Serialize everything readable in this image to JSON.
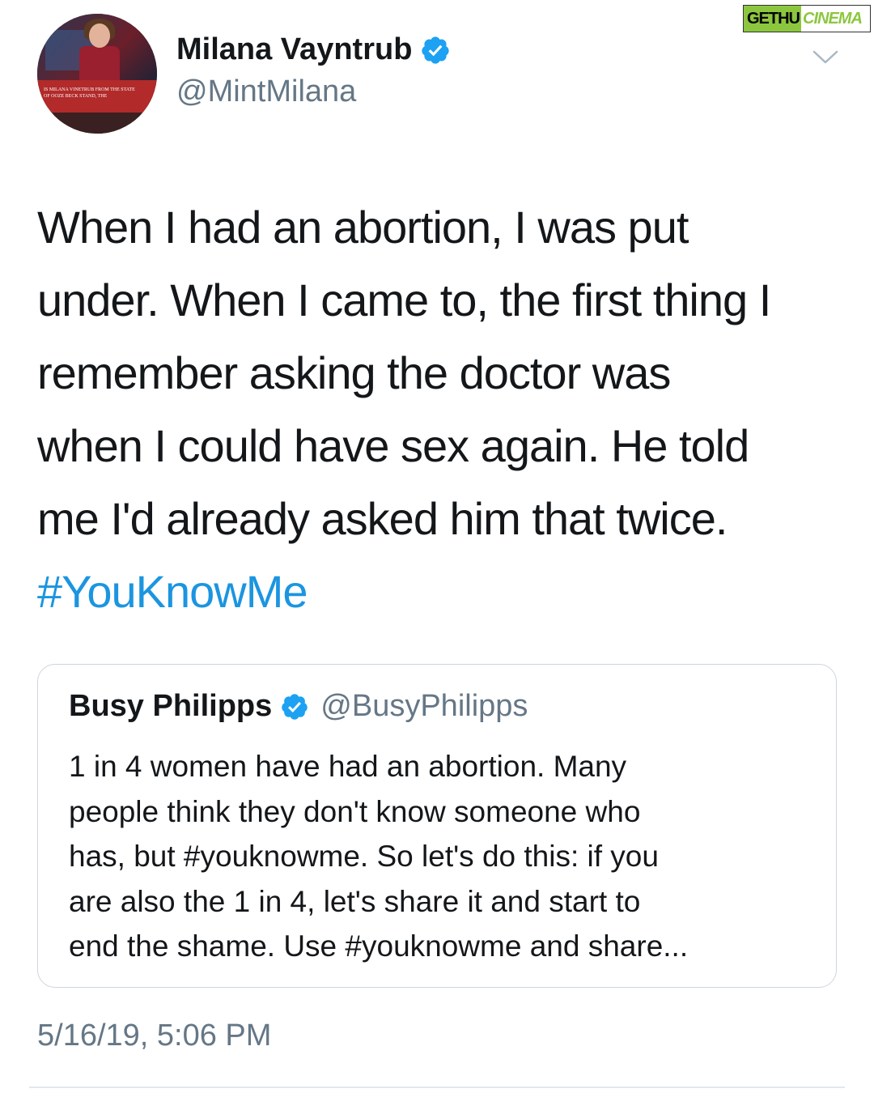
{
  "watermark": {
    "part1": "GETHU",
    "part2": "CINEMA"
  },
  "author": {
    "display_name": "Milana Vayntrub",
    "handle": "@MintMilana",
    "avatar_caption": "IS MILANA VINETRUB FROM THE STATE OF OOZE BECK STAND, THE"
  },
  "tweet": {
    "lines": [
      "When I had an abortion, I was put",
      "under. When I came to, the first thing I",
      "remember asking the doctor was",
      "when I could have sex again. He told",
      "me I'd already asked him that twice."
    ],
    "hashtag": "#YouKnowMe",
    "timestamp": "5/16/19, 5:06 PM"
  },
  "quoted": {
    "display_name": "Busy Philipps",
    "handle": "@BusyPhilipps",
    "lines": [
      "1 in 4 women have had an abortion. Many",
      "people think they don't know someone who",
      "has, but #youknowme. So let's do this: if you",
      "are also the 1 in 4, let's share it and start to",
      "end the shame. Use #youknowme and share..."
    ]
  },
  "colors": {
    "text": "#14171a",
    "secondary": "#657786",
    "link": "#1b95e0",
    "verified": "#1da1f2",
    "border": "#ccd6dd"
  }
}
